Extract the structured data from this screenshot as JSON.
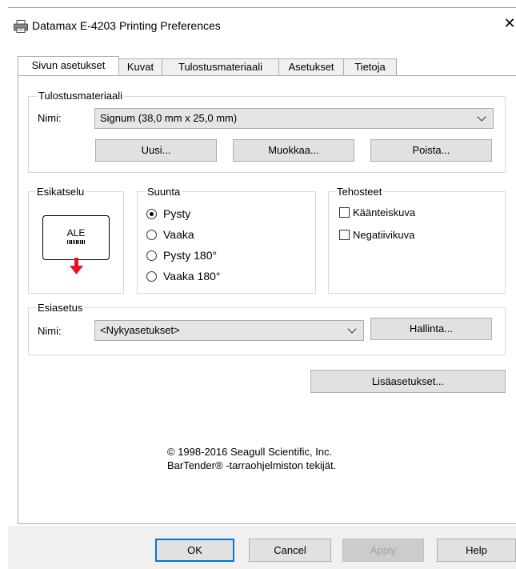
{
  "window": {
    "title": "Datamax E-4203 Printing Preferences",
    "close_glyph": "✕"
  },
  "tabs": [
    {
      "label": "Sivun asetukset",
      "active": true
    },
    {
      "label": "Kuvat"
    },
    {
      "label": "Tulostusmateriaali"
    },
    {
      "label": "Asetukset"
    },
    {
      "label": "Tietoja"
    }
  ],
  "media_group": {
    "legend": "Tulostusmateriaali",
    "name_label": "Nimi:",
    "name_value": "Signum (38,0 mm x 25,0 mm)",
    "buttons": {
      "new": "Uusi...",
      "edit": "Muokkaa...",
      "delete": "Poista..."
    }
  },
  "preview_group": {
    "legend": "Esikatselu",
    "label_text": "ALE"
  },
  "orientation_group": {
    "legend": "Suunta",
    "options": [
      "Pysty",
      "Vaaka",
      "Pysty 180°",
      "Vaaka 180°"
    ],
    "selected": "Pysty"
  },
  "effects_group": {
    "legend": "Tehosteet",
    "options": [
      "Käänteiskuva",
      "Negatiivikuva"
    ]
  },
  "preset_group": {
    "legend": "Esiasetus",
    "name_label": "Nimi:",
    "name_value": "<Nykyasetukset>",
    "manage_button": "Hallinta..."
  },
  "advanced_button": "Lisäasetukset...",
  "copyright": {
    "line1": "© 1998-2016 Seagull Scientific, Inc.",
    "line2": "BarTender® -tarraohjelmiston tekijät."
  },
  "footer_buttons": {
    "ok": "OK",
    "cancel": "Cancel",
    "apply": "Apply",
    "help": "Help"
  },
  "colors": {
    "accent": "#0078d7",
    "arrow": "#e81123",
    "dialog_bg": "#f0f0f0"
  }
}
